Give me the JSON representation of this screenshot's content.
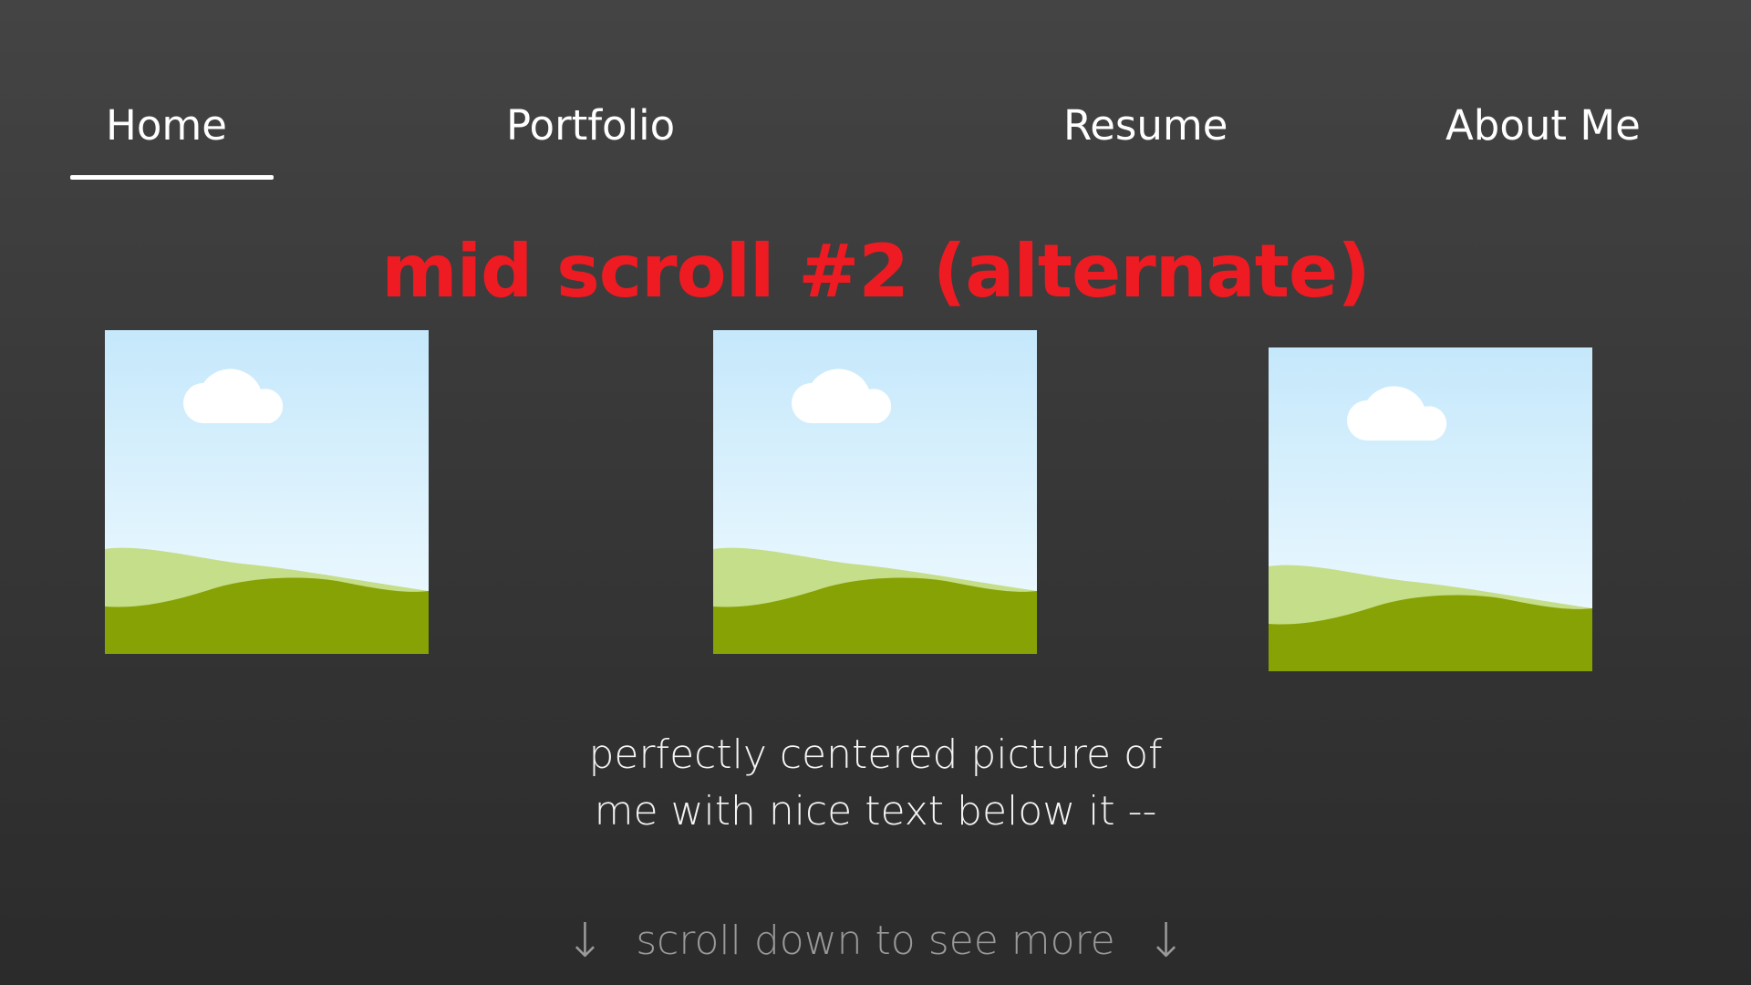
{
  "nav": {
    "home": "Home",
    "portfolio": "Portfolio",
    "resume": "Resume",
    "about": "About Me",
    "active": "Home"
  },
  "heading": "mid scroll #2 (alternate)",
  "images": [
    {
      "icon": "landscape-placeholder-icon"
    },
    {
      "icon": "landscape-placeholder-icon"
    },
    {
      "icon": "landscape-placeholder-icon"
    }
  ],
  "caption": {
    "line1": "perfectly centered picture of",
    "line2": "me with nice text below it --"
  },
  "scroll_hint": {
    "text": "scroll down to see more",
    "arrow_left": "↓",
    "arrow_right": "↓"
  },
  "colors": {
    "background_top": "#444444",
    "background_bottom": "#2b2b2b",
    "heading": "#ee1b22",
    "nav_text": "#ffffff",
    "scroll_hint": "#9a9a9a",
    "sky_top": "#c5e8fb",
    "sky_bottom": "#eefaff",
    "hill_light": "#c5de8a",
    "hill_dark": "#86a204",
    "cloud": "#ffffff"
  }
}
